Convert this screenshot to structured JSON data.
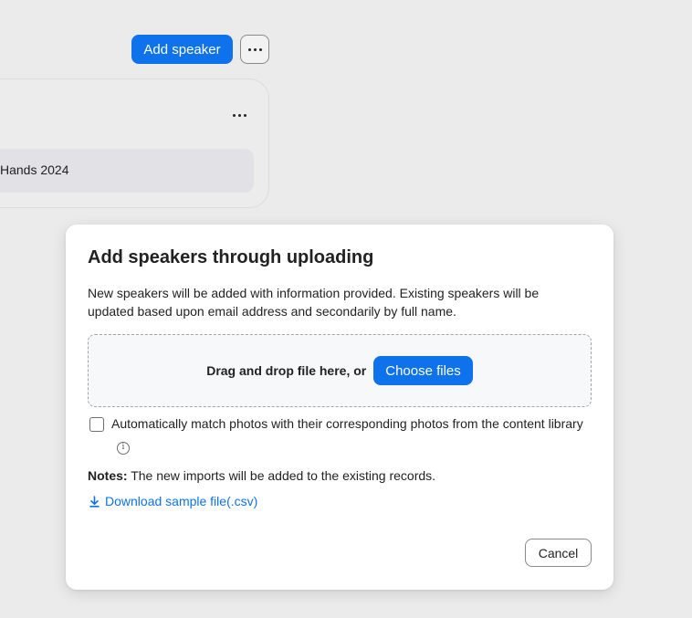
{
  "toolbar": {
    "add_speaker_label": "Add speaker",
    "more_icon": "ellipsis-icon"
  },
  "background_card": {
    "row_label": "Hands 2024",
    "more_icon": "ellipsis-icon"
  },
  "modal": {
    "title": "Add speakers through uploading",
    "description": "New speakers will be added with information provided. Existing speakers will be updated based upon email address and secondarily by full name.",
    "dropzone": {
      "text": "Drag and drop file here, or",
      "button_label": "Choose files"
    },
    "auto_match": {
      "checked": false,
      "label": "Automatically match photos with their corresponding photos from the content library",
      "info_glyph": "i"
    },
    "notes": {
      "label": "Notes:",
      "text": "The new imports will be added to the existing records."
    },
    "download": {
      "icon": "download-icon",
      "label": "Download sample file(.csv)"
    },
    "cancel_label": "Cancel"
  },
  "colors": {
    "accent": "#0e72ed",
    "page_background": "#ebebeb",
    "modal_background": "#ffffff",
    "dropzone_background": "#f7f8fa"
  }
}
